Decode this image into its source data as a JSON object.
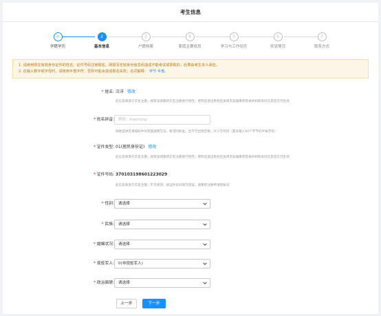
{
  "header": {
    "title": "考生信息"
  },
  "steps": [
    {
      "num": "✓",
      "label": "学籍学历",
      "state": "done"
    },
    {
      "num": "2",
      "label": "基本信息",
      "state": "active"
    },
    {
      "num": "3",
      "label": "户籍档案",
      "state": "todo"
    },
    {
      "num": "4",
      "label": "家庭主要成员",
      "state": "todo"
    },
    {
      "num": "5",
      "label": "学习与工作经历",
      "state": "todo"
    },
    {
      "num": "6",
      "label": "奖惩情况",
      "state": "todo"
    },
    {
      "num": "7",
      "label": "联系方式",
      "state": "todo"
    }
  ],
  "notice": {
    "line1": "1. 请使用现在有效身份证件的姓名、证件号码注册报名。网报写无效身份信息而造成不能考试或录取的，后果由考生本人承担。",
    "line2_prefix": "2. 在输入数字或字母时，请使用半角字符，否则可能会造成报名失败；名词解释：",
    "line2_link1": "字节",
    "line2_link2": "半角",
    "line2_suffix": "。"
  },
  "form": {
    "name": {
      "label": "姓名:",
      "value": "汪洋",
      "edit": "修改",
      "hint": "此信息来源于实名注册，如有误请重新实名注册进行修改，修改后退出系统且关闭浏览器重新登录并刷新身份信息后方可生效"
    },
    "pinyin": {
      "label": "姓名拼音:",
      "placeholder": "例如：xiaoming",
      "hint": "除姓名拼音请按照中华民国通用写法，要求同标准，且不可出现空格，大小写均可（最多输入60个字节的半角字符）"
    },
    "id_type": {
      "label": "证件类型:",
      "value": "01(居民身份证)",
      "edit": "修改",
      "hint": "此信息来源于实名注册，如有误请重新实名注册进行修改，修改后退出系统且关闭浏览器重新登录并刷新身份信息后方可生效"
    },
    "id_number": {
      "label": "证件号码:",
      "value": "370103198601223029",
      "hint": "此信息来源于实名注册，不可修改，如证件号码填写错误，请重新注册申请新账号"
    },
    "gender": {
      "label": "性别:",
      "value": "请选择"
    },
    "ethnicity": {
      "label": "民族:",
      "value": "请选择"
    },
    "marital": {
      "label": "婚姻状况:",
      "value": "请选择"
    },
    "military": {
      "label": "现役军人:",
      "value": "0(非现役军人)"
    },
    "political": {
      "label": "政治面貌:",
      "value": "请选择"
    }
  },
  "buttons": {
    "prev": "上一步",
    "next": "下一步"
  },
  "colors": {
    "accent": "#1890ff",
    "required": "#f5222d",
    "notice_bg": "#fdf6e6",
    "notice_text": "#b7791f"
  }
}
